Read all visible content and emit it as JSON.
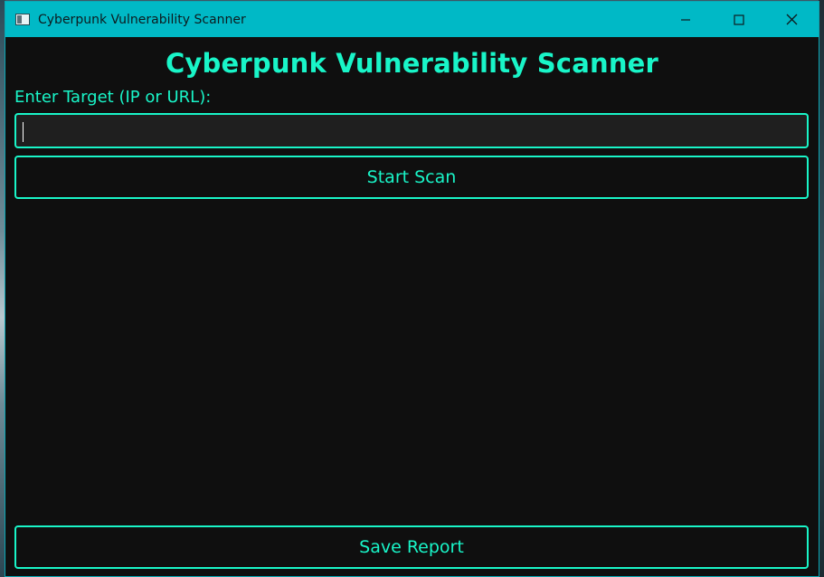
{
  "window": {
    "title": "Cyberpunk Vulnerability Scanner",
    "titlebar_color": "#00b9c6",
    "controls": [
      "minimize-icon",
      "maximize-icon",
      "close-icon"
    ]
  },
  "app": {
    "heading": "Cyberpunk Vulnerability Scanner",
    "target_label": "Enter Target (IP or URL):",
    "target_value": "",
    "start_button": "Start Scan",
    "save_button": "Save Report",
    "accent_color": "#19f5c8",
    "background_color": "#0f0f0f"
  }
}
